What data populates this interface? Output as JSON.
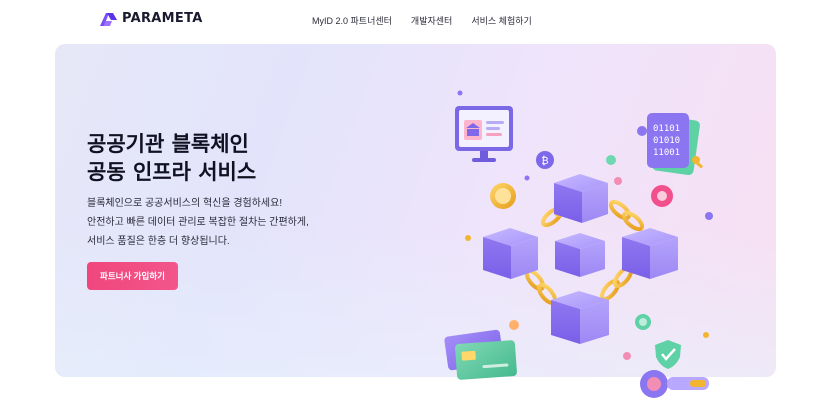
{
  "brand": {
    "name": "PARAMETA"
  },
  "nav": [
    {
      "label": "MyID 2.0 파트너센터"
    },
    {
      "label": "개발자센터"
    },
    {
      "label": "서비스 체험하기"
    }
  ],
  "hero": {
    "title_lines": [
      "공공기관 블록체인",
      "공동 인프라 서비스"
    ],
    "description_lines": [
      "블록체인으로 공공서비스의 혁신을 경험하세요!",
      "안전하고 빠른 데이터 관리로 복잡한 절차는 간편하게,",
      "서비스 품질은 한층 더 향상됩니다."
    ],
    "cta_label": "파트너사 가입하기"
  },
  "illustration": {
    "binary_lines": [
      "01101",
      "01010",
      "11001"
    ],
    "coin_symbol": "₿"
  },
  "colors": {
    "brand_purple": "#6a3df0",
    "cta_pink": "#f0467e",
    "cube_purple": "#8f7bf2",
    "chain_gold": "#f2b531"
  }
}
